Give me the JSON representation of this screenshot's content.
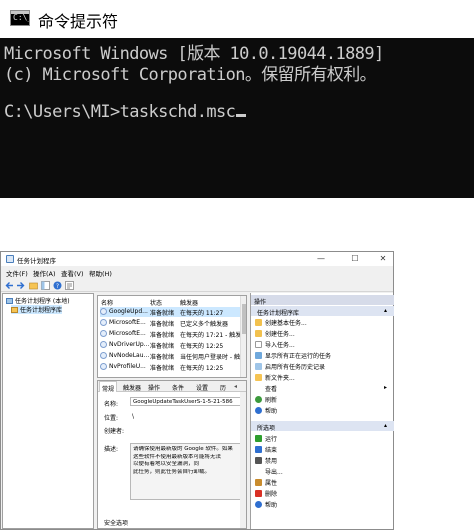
{
  "cmd": {
    "title": "命令提示符",
    "icon": "C:\\_",
    "lines": [
      "Microsoft Windows [版本 10.0.19044.1889]",
      "(c) Microsoft Corporation。保留所有权利。",
      "",
      "C:\\Users\\MI>taskschd.msc"
    ]
  },
  "ts": {
    "title": "任务计划程序",
    "window_controls": {
      "minimize": "—",
      "maximize": "☐",
      "close": "✕"
    },
    "menu": [
      "文件(F)",
      "操作(A)",
      "查看(V)",
      "帮助(H)"
    ],
    "tree": [
      {
        "label": "任务计划程序 (本地)"
      },
      {
        "label": "任务计划程序库"
      }
    ],
    "list": {
      "columns": [
        "名称",
        "状态",
        "触发器"
      ],
      "rows": [
        {
          "name": "GoogleUpd...",
          "status": "准备就绪",
          "trigger": "在每天的 11:27"
        },
        {
          "name": "MicrosoftE...",
          "status": "准备就绪",
          "trigger": "已定义多个触发器"
        },
        {
          "name": "MicrosoftE...",
          "status": "准备就绪",
          "trigger": "在每天的 17:21 - 触发"
        },
        {
          "name": "NvDriverUp...",
          "status": "准备就绪",
          "trigger": "在每天的 12:25"
        },
        {
          "name": "NvNodeLau...",
          "status": "准备就绪",
          "trigger": "当任何用户登录时 - 触"
        },
        {
          "name": "NvProfileU...",
          "status": "准备就绪",
          "trigger": "在每天的 12:25"
        }
      ]
    },
    "detail": {
      "tabs": [
        "常规",
        "触发器",
        "操作",
        "条件",
        "设置",
        "历"
      ],
      "name_label": "名称:",
      "name_value": "GoogleUpdateTaskUserS-1-5-21-586",
      "location_label": "位置:",
      "location_value": "\\",
      "author_label": "创建者:",
      "desc_label": "描述:",
      "desc_lines": [
        "请确保使用最新版的 Google 软件。如果",
        "这些软件不使用最新版本可能将无法",
        "以便有着地以安全漏洞，同",
        "此任务，则此任务会自行卸载。"
      ],
      "security_label": "安全选项"
    },
    "actions": {
      "header": "操作",
      "section1": "任务计划程序库",
      "items1": [
        {
          "label": "创建基本任务...",
          "icon": "create-basic-task-icon",
          "color": "#f2c14e"
        },
        {
          "label": "创建任务...",
          "icon": "create-task-icon",
          "color": "#f2c14e"
        },
        {
          "label": "导入任务...",
          "icon": "import-icon",
          "color": "#ffffff"
        },
        {
          "label": "显示所有正在运行的任务",
          "icon": "running-tasks-icon",
          "color": "#6fa8dc"
        },
        {
          "label": "启用所有任务历史记录",
          "icon": "history-icon",
          "color": "#9fc5e8"
        },
        {
          "label": "新文件夹...",
          "icon": "folder-icon",
          "color": "#f6c453"
        },
        {
          "label": "查看",
          "icon": "view-icon",
          "color": "#ffffff",
          "submenu": true
        },
        {
          "label": "刷新",
          "icon": "refresh-icon",
          "color": "#3c9a3c"
        },
        {
          "label": "帮助",
          "icon": "help-icon",
          "color": "#2f6fd0"
        }
      ],
      "section2": "所选项",
      "items2": [
        {
          "label": "运行",
          "icon": "run-icon",
          "color": "#2e9e2e"
        },
        {
          "label": "结束",
          "icon": "end-icon",
          "color": "#2e6fd0"
        },
        {
          "label": "禁用",
          "icon": "disable-icon",
          "color": "#555555"
        },
        {
          "label": "导出...",
          "icon": "export-icon",
          "color": "#ffffff"
        },
        {
          "label": "属性",
          "icon": "properties-icon",
          "color": "#c98c2e"
        },
        {
          "label": "删除",
          "icon": "delete-icon",
          "color": "#d93025"
        },
        {
          "label": "帮助",
          "icon": "help-icon",
          "color": "#2f6fd0"
        }
      ]
    }
  }
}
